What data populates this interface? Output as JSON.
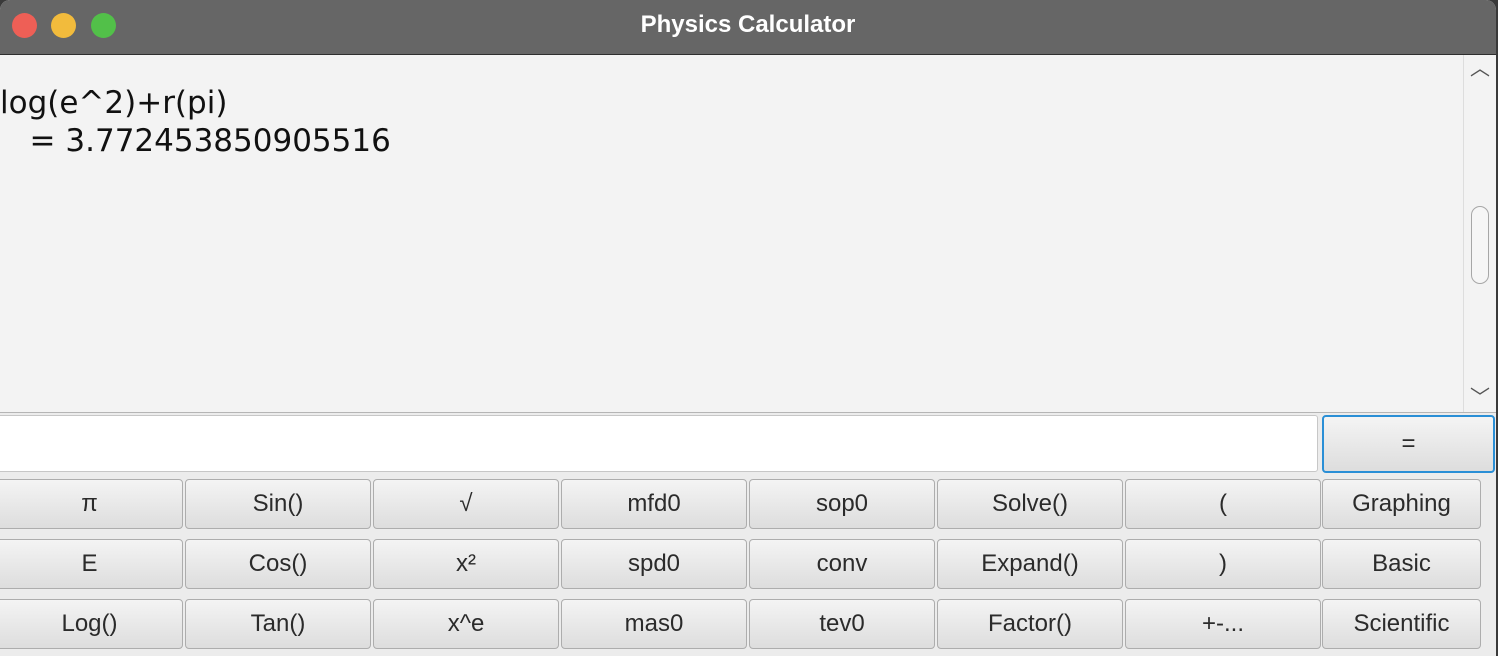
{
  "window": {
    "title": "Physics Calculator"
  },
  "output": {
    "lines": [
      "log(e^2)+r(pi)",
      "   = 3.772453850905516"
    ]
  },
  "input": {
    "value": "",
    "equals_label": "="
  },
  "keypad": {
    "rows": [
      [
        "π",
        "Sin()",
        "√",
        "mfd0",
        "sop0",
        "Solve()",
        "(",
        "Graphing"
      ],
      [
        "E",
        "Cos()",
        "x²",
        "spd0",
        "conv",
        "Expand()",
        ")",
        "Basic"
      ],
      [
        "Log()",
        "Tan()",
        "x^e",
        "mas0",
        "tev0",
        "Factor()",
        "+-...",
        "Scientific"
      ]
    ]
  },
  "icons": {
    "close": "close-traffic-light",
    "minimize": "minimize-traffic-light",
    "maximize": "maximize-traffic-light",
    "scroll_up": "chevron-up-icon",
    "scroll_down": "chevron-down-icon"
  }
}
